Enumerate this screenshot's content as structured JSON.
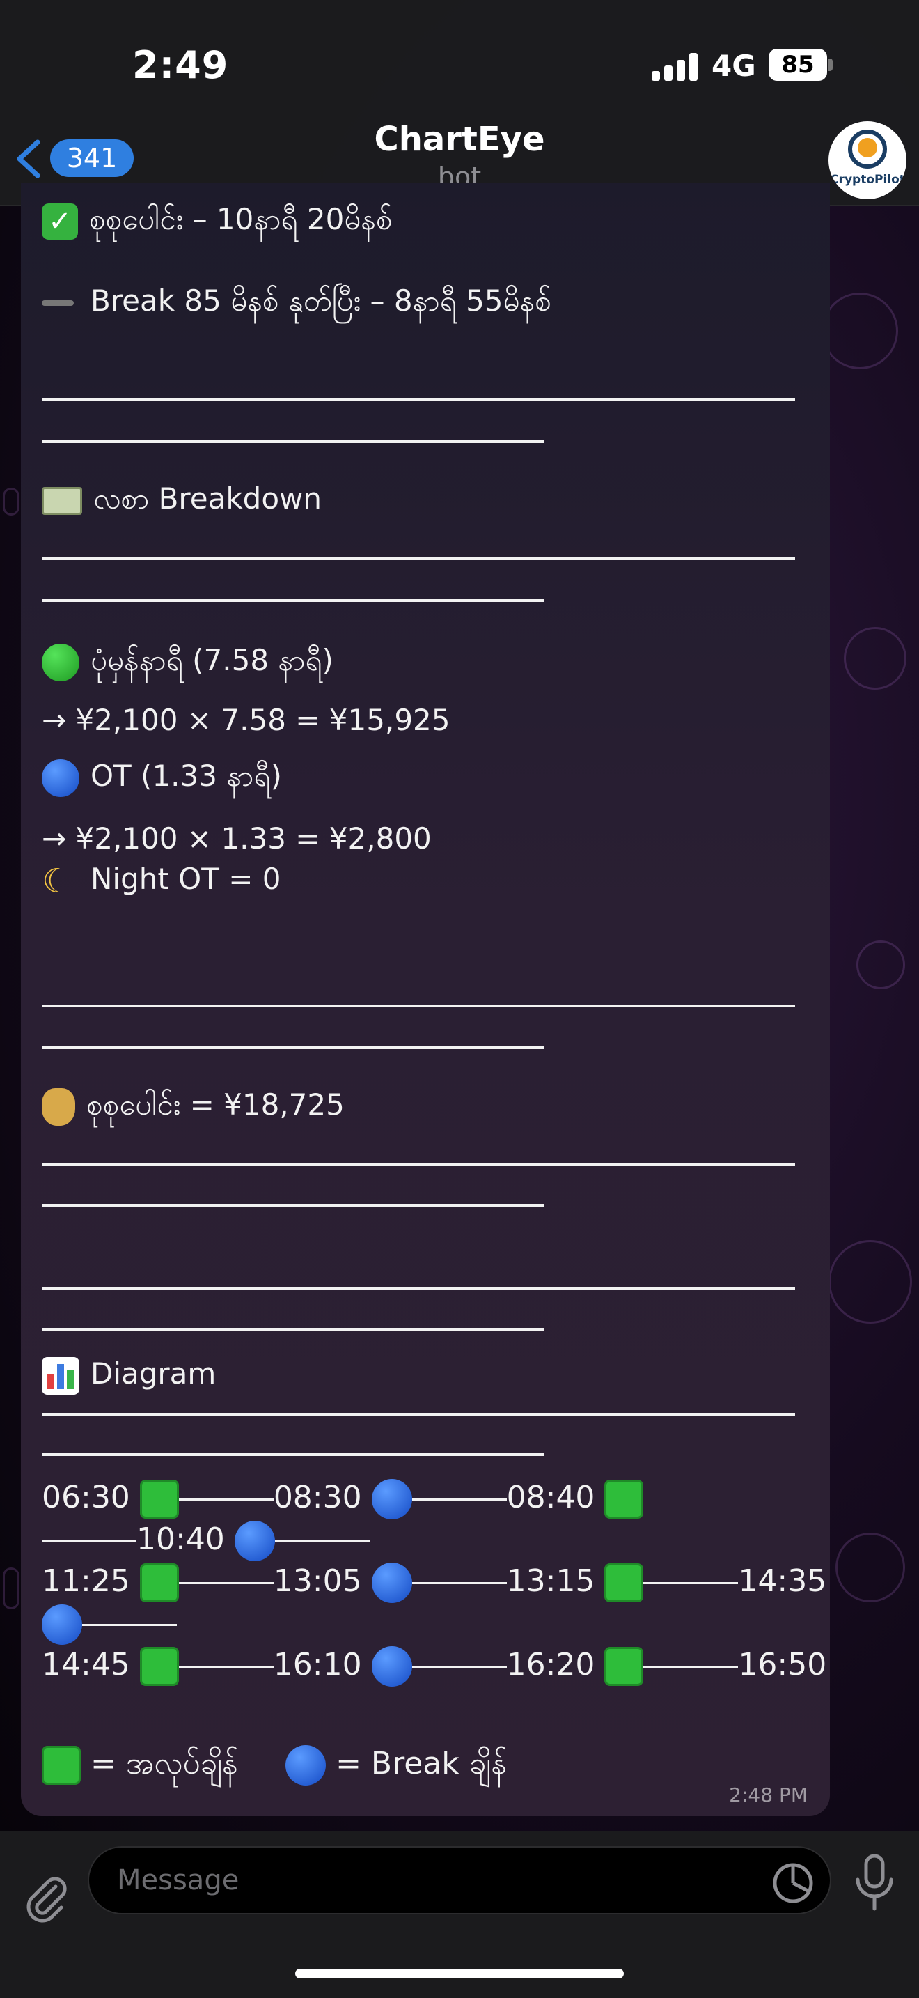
{
  "status_bar": {
    "time": "2:49",
    "network": "4G",
    "battery": "85"
  },
  "header": {
    "back_count": "341",
    "title": "ChartEye",
    "subtitle": "bot",
    "avatar_text": "CryptoPilot"
  },
  "message": {
    "total_time": "စုစုပေါင်း – 10နာရီ 20မိနစ်",
    "break_line": "Break 85 မိနစ် နုတ်ပြီး – 8နာရီ 55မိနစ်",
    "breakdown_heading": "လစာ Breakdown",
    "basic_label": "ပုံမှန်နာရီ (7.58 နာရီ)",
    "basic_calc": "→ ¥2,100 × 7.58 = ¥15,925",
    "ot_label": "OT (1.33 နာရီ)",
    "ot_calc": "→ ¥2,100 × 1.33 = ¥2,800",
    "night_ot": "Night OT = 0",
    "total_pay": "စုစုပေါင်း = ¥18,725",
    "diagram_heading": "Diagram",
    "diagram": {
      "t0630": "06:30",
      "t0830": "08:30",
      "t0840": "08:40",
      "t1040": "10:40",
      "t1125": "11:25",
      "t1305": "13:05",
      "t1315": "13:15",
      "t1435": "14:35",
      "t1445": "14:45",
      "t1610": "16:10",
      "t1620": "16:20",
      "t1650": "16:50"
    },
    "legend_work": "= အလုပ်ချိန်",
    "legend_break": "= Break ချိန်",
    "time": "2:48 PM"
  },
  "composer": {
    "placeholder": "Message"
  },
  "colors": {
    "accent": "#2f7fe0",
    "work_green": "#2ebd3a",
    "break_blue": "#1c5fe0"
  },
  "icons": [
    "back-chevron-icon",
    "check-icon",
    "minus-icon",
    "money-icon",
    "green-circle-icon",
    "blue-circle-icon",
    "moon-icon",
    "money-bag-icon",
    "bar-chart-icon",
    "green-square-icon",
    "paperclip-icon",
    "sticker-icon",
    "microphone-icon"
  ]
}
